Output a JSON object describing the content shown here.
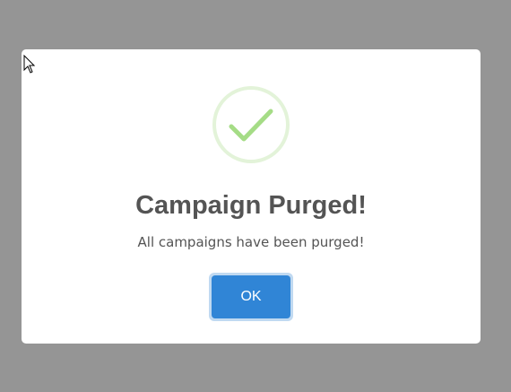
{
  "dialog": {
    "title": "Campaign Purged!",
    "message": "All campaigns have been purged!",
    "ok_label": "OK",
    "icon": "success-check-icon"
  },
  "colors": {
    "backdrop": "#959595",
    "modal_bg": "#ffffff",
    "success_ring": "#e3f3d9",
    "success_check": "#a5dc86",
    "title_text": "#545454",
    "button_bg": "#3085d6",
    "button_text": "#ffffff"
  }
}
